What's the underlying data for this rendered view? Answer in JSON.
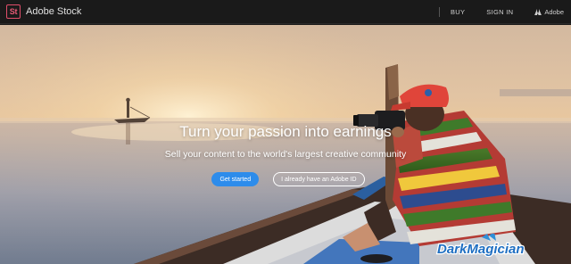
{
  "header": {
    "logo_text": "St",
    "brand": "Adobe Stock",
    "nav": {
      "buy": "BUY",
      "sign_in": "SIGN IN",
      "adobe": "Adobe"
    }
  },
  "hero": {
    "headline": "Turn your passion into earnings",
    "subline": "Sell your content to the world's largest creative community",
    "cta_primary": "Get started",
    "cta_secondary": "I already have an Adobe ID"
  },
  "watermark": {
    "text": "DarkMagician"
  },
  "colors": {
    "logo_accent": "#e14e6b",
    "primary_button": "#2d8ceb",
    "topbar": "#1a1a1a",
    "cap": "#e0453a"
  }
}
